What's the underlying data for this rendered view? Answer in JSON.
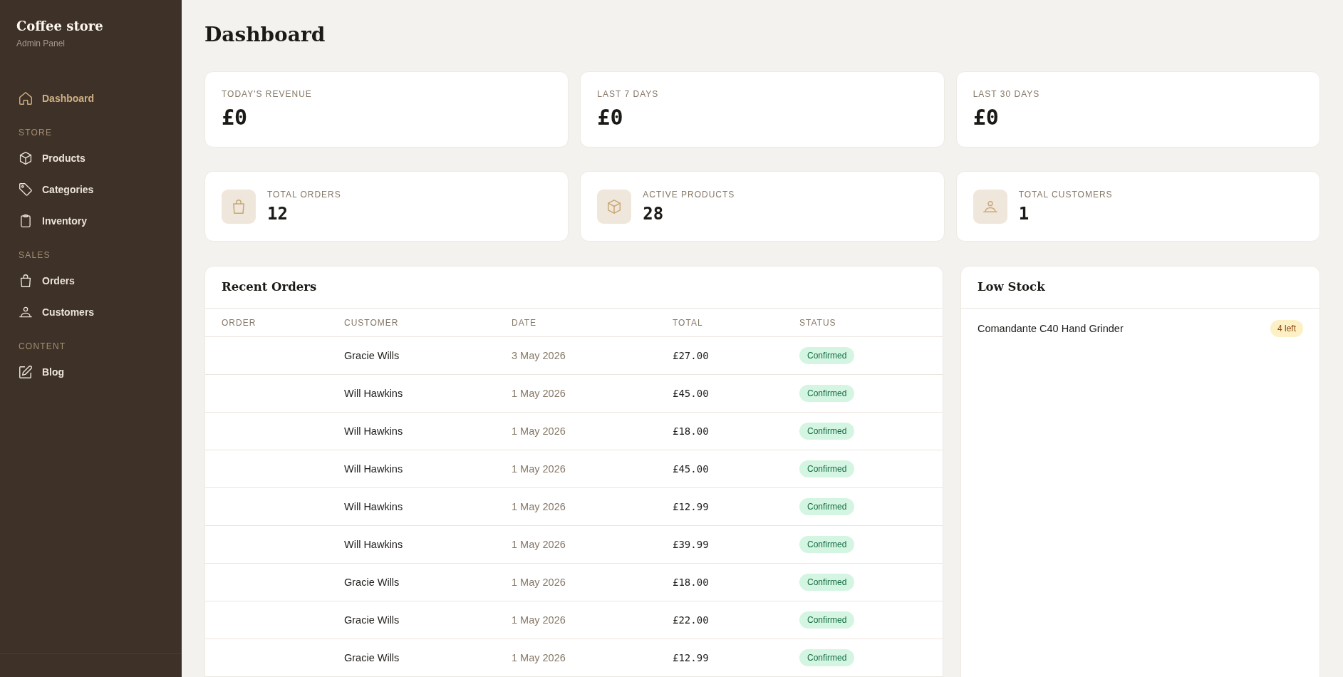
{
  "sidebar": {
    "brand": "Coffee store",
    "subtitle": "Admin Panel",
    "groups": [
      {
        "items": [
          {
            "label": "Dashboard",
            "selected": true
          }
        ]
      },
      {
        "heading": "STORE",
        "items": [
          {
            "label": "Products",
            "selected": false
          },
          {
            "label": "Categories",
            "selected": false
          },
          {
            "label": "Inventory",
            "selected": false
          }
        ]
      },
      {
        "heading": "SALES",
        "items": [
          {
            "label": "Orders",
            "selected": false
          },
          {
            "label": "Customers",
            "selected": false
          }
        ]
      },
      {
        "heading": "CONTENT",
        "items": [
          {
            "label": "Blog",
            "selected": false
          }
        ]
      }
    ]
  },
  "page": {
    "title": "Dashboard"
  },
  "revenue_cards": [
    {
      "label": "TODAY'S REVENUE",
      "value": "£0"
    },
    {
      "label": "LAST 7 DAYS",
      "value": "£0"
    },
    {
      "label": "LAST 30 DAYS",
      "value": "£0"
    }
  ],
  "count_cards": [
    {
      "label": "TOTAL ORDERS",
      "value": "12"
    },
    {
      "label": "ACTIVE PRODUCTS",
      "value": "28"
    },
    {
      "label": "TOTAL CUSTOMERS",
      "value": "1"
    }
  ],
  "recent_orders": {
    "title": "Recent Orders",
    "columns": [
      "ORDER",
      "CUSTOMER",
      "DATE",
      "TOTAL",
      "STATUS"
    ],
    "rows": [
      {
        "customer": "Gracie Wills",
        "date": "3 May 2026",
        "total": "£27.00",
        "status": "Confirmed"
      },
      {
        "customer": "Will Hawkins",
        "date": "1 May 2026",
        "total": "£45.00",
        "status": "Confirmed"
      },
      {
        "customer": "Will Hawkins",
        "date": "1 May 2026",
        "total": "£18.00",
        "status": "Confirmed"
      },
      {
        "customer": "Will Hawkins",
        "date": "1 May 2026",
        "total": "£45.00",
        "status": "Confirmed"
      },
      {
        "customer": "Will Hawkins",
        "date": "1 May 2026",
        "total": "£12.99",
        "status": "Confirmed"
      },
      {
        "customer": "Will Hawkins",
        "date": "1 May 2026",
        "total": "£39.99",
        "status": "Confirmed"
      },
      {
        "customer": "Gracie Wills",
        "date": "1 May 2026",
        "total": "£18.00",
        "status": "Confirmed"
      },
      {
        "customer": "Gracie Wills",
        "date": "1 May 2026",
        "total": "£22.00",
        "status": "Confirmed"
      },
      {
        "customer": "Gracie Wills",
        "date": "1 May 2026",
        "total": "£12.99",
        "status": "Confirmed"
      }
    ]
  },
  "low_stock": {
    "title": "Low Stock",
    "items": [
      {
        "name": "Comandante C40 Hand Grinder",
        "badge": "4 left"
      }
    ]
  }
}
